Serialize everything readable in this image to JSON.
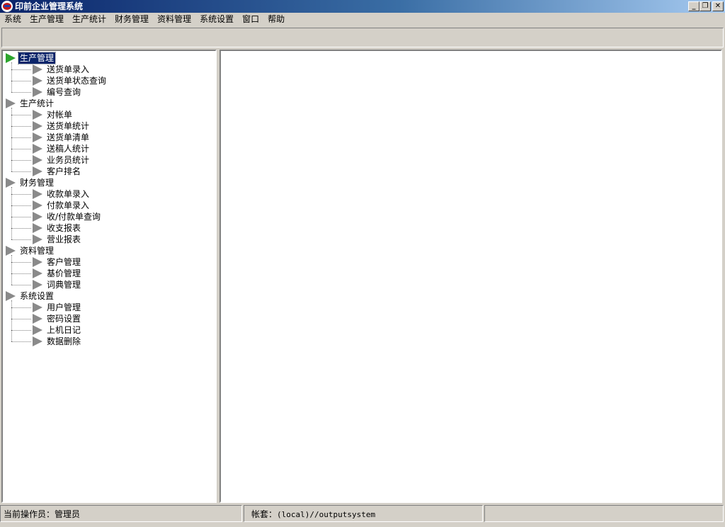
{
  "window": {
    "title": "印前企业管理系统"
  },
  "menu": [
    "系统",
    "生产管理",
    "生产统计",
    "财务管理",
    "资料管理",
    "系统设置",
    "窗口",
    "帮助"
  ],
  "tree": [
    {
      "label": "生产管理",
      "selected": true,
      "children": [
        "送货单录入",
        "送货单状态查询",
        "编号查询"
      ]
    },
    {
      "label": "生产统计",
      "selected": false,
      "children": [
        "对帐单",
        "送货单统计",
        "送货单清单",
        "送稿人统计",
        "业务员统计",
        "客户排名"
      ]
    },
    {
      "label": "财务管理",
      "selected": false,
      "children": [
        "收款单录入",
        "付款单录入",
        "收/付款单查询",
        "收支报表",
        "营业报表"
      ]
    },
    {
      "label": "资料管理",
      "selected": false,
      "children": [
        "客户管理",
        "基价管理",
        "词典管理"
      ]
    },
    {
      "label": "系统设置",
      "selected": false,
      "children": [
        "用户管理",
        "密码设置",
        "上机日记",
        "数据删除"
      ]
    }
  ],
  "status": {
    "operator": "当前操作员：管理员",
    "account_label": "帐套：",
    "account_value": "(local)//outputsystem"
  },
  "colors": {
    "title_start": "#0a246a",
    "selected_bg": "#0a246a",
    "active_arrow": "#2ea52e",
    "arrow": "#8a8a8a"
  }
}
